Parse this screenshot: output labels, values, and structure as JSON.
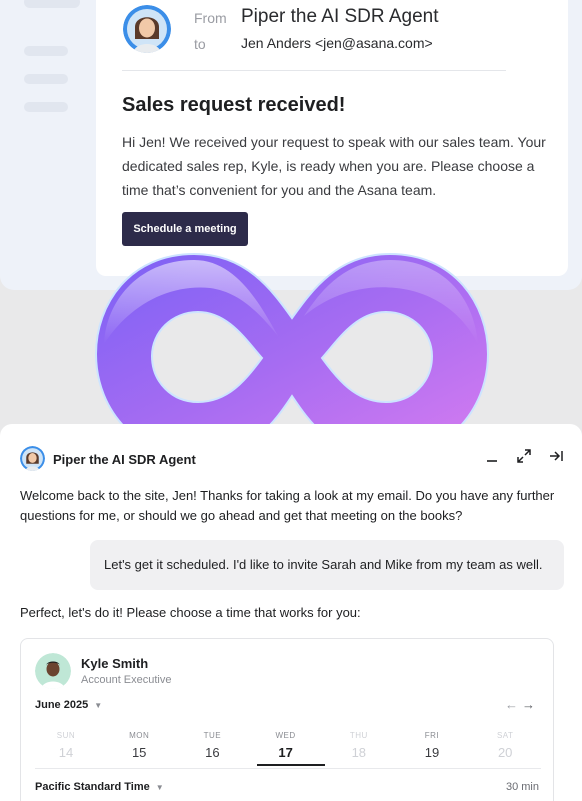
{
  "email": {
    "from_label": "From",
    "from_name": "Piper the AI SDR Agent",
    "to_label": "to",
    "to_value": "Jen Anders <jen@asana.com>",
    "heading": "Sales request received!",
    "body": "Hi Jen! We received your request to speak with our sales team. Your dedicated sales rep, Kyle, is ready when you are. Please choose a time that’s convenient for you and the Asana team.",
    "cta_label": "Schedule a meeting"
  },
  "chat": {
    "agent_name": "Piper the AI SDR Agent",
    "controls": [
      "minimize-icon",
      "expand-icon",
      "collapse-to-side-icon"
    ],
    "messages": [
      {
        "role": "agent",
        "text": "Welcome back to the site, Jen! Thanks for taking a look at my email. Do you have any further questions for me, or should we go ahead and get that meeting on the books?"
      },
      {
        "role": "user",
        "text": "Let's get it scheduled. I'd like to invite Sarah and Mike from my team as well."
      },
      {
        "role": "agent",
        "text": "Perfect, let's do it! Please choose a time that works for you:"
      }
    ]
  },
  "scheduler": {
    "rep_name": "Kyle Smith",
    "rep_title": "Account Executive",
    "month": "June 2025",
    "nav_prev": "←",
    "nav_next": "→",
    "days": [
      {
        "dow": "SUN",
        "num": "14",
        "disabled": true
      },
      {
        "dow": "MON",
        "num": "15",
        "disabled": false
      },
      {
        "dow": "TUE",
        "num": "16",
        "disabled": false
      },
      {
        "dow": "WED",
        "num": "17",
        "disabled": false,
        "selected": true
      },
      {
        "dow": "THU",
        "num": "18",
        "disabled": true
      },
      {
        "dow": "FRI",
        "num": "19",
        "disabled": false
      },
      {
        "dow": "SAT",
        "num": "20",
        "disabled": true
      }
    ],
    "timezone": "Pacific Standard Time",
    "duration": "30 min"
  },
  "colors": {
    "cta_bg": "#2d2b4a",
    "infinity_start": "#7b61f5",
    "infinity_end": "#d77cf0"
  }
}
